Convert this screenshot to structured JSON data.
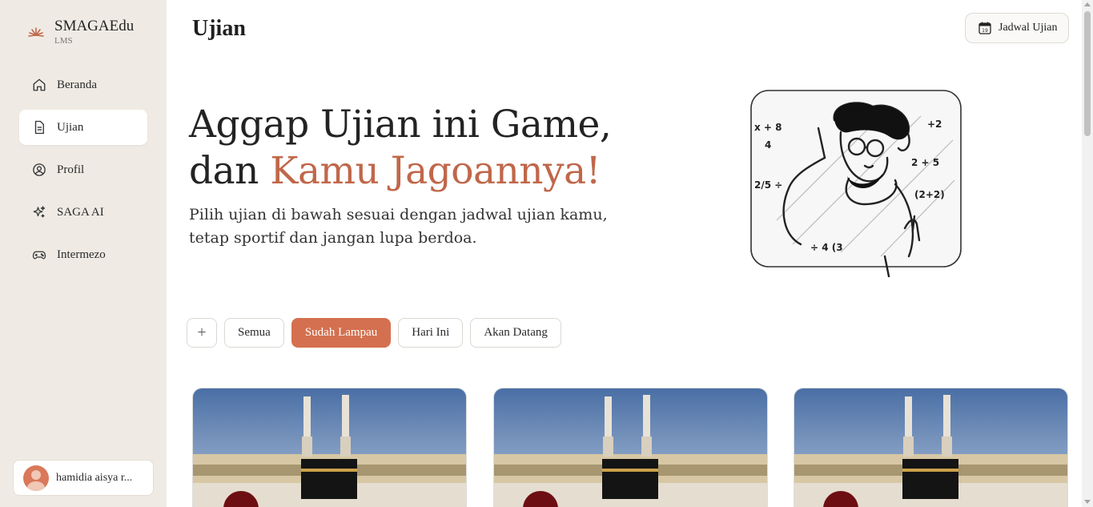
{
  "brand": {
    "name": "SMAGAEdu",
    "subtitle": "LMS"
  },
  "sidebar": {
    "items": [
      {
        "label": "Beranda",
        "icon": "home-icon",
        "active": false
      },
      {
        "label": "Ujian",
        "icon": "document-icon",
        "active": true
      },
      {
        "label": "Profil",
        "icon": "user-circle-icon",
        "active": false
      },
      {
        "label": "SAGA AI",
        "icon": "sparkles-icon",
        "active": false
      },
      {
        "label": "Intermezo",
        "icon": "gamepad-icon",
        "active": false
      }
    ],
    "user": {
      "name": "hamidia aisya r..."
    }
  },
  "header": {
    "title": "Ujian",
    "schedule_button": "Jadwal Ujian",
    "calendar_day": "19"
  },
  "hero": {
    "line1": "Aggap Ujian ini Game,",
    "line2_plain": "dan ",
    "line2_accent": "Kamu Jagoannya!",
    "subtitle_line1": "Pilih ujian di bawah sesuai dengan jadwal ujian kamu,",
    "subtitle_line2": "tetap sportif dan jangan lupa berdoa.",
    "illustration_texts": [
      "x + 8",
      "4",
      "+2",
      "2 + 5",
      "2/5 ÷",
      "(2+2)",
      "÷ 4 (3"
    ]
  },
  "filters": {
    "add_symbol": "+",
    "items": [
      {
        "label": "Semua",
        "active": false
      },
      {
        "label": "Sudah Lampau",
        "active": true
      },
      {
        "label": "Hari Ini",
        "active": false
      },
      {
        "label": "Akan Datang",
        "active": false
      }
    ]
  },
  "colors": {
    "accent": "#c0674a",
    "chip_active": "#d4704f",
    "sidebar_bg": "#efebe4"
  }
}
